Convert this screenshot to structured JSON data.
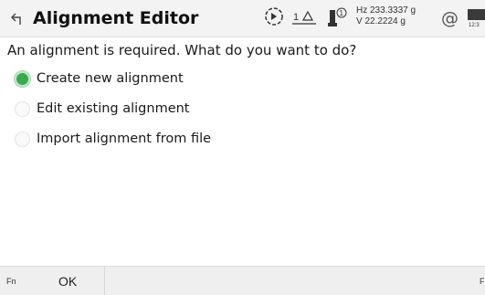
{
  "header": {
    "title": "Alignment Editor",
    "hz_label": "Hz 233.3337 g",
    "v_label": "V  22.2224 g",
    "at_symbol": "@",
    "clock": "12:3",
    "icons": [
      "back-icon",
      "target-search-icon",
      "prism-icon",
      "instrument-face-icon",
      "at-icon",
      "battery-icon"
    ],
    "prism_constant": "1",
    "face_number": "1"
  },
  "main": {
    "question": "An alignment is required. What do you want to do?",
    "options": [
      {
        "label": "Create new alignment",
        "selected": true
      },
      {
        "label": "Edit existing alignment",
        "selected": false
      },
      {
        "label": "Import alignment from file",
        "selected": false
      }
    ]
  },
  "footer": {
    "fn_left": "Fn",
    "fn_right": "F",
    "ok_label": "OK"
  },
  "colors": {
    "selected_radio": "#3aa850",
    "header_bg": "#f3f3f3",
    "footer_bg": "#efefef"
  }
}
